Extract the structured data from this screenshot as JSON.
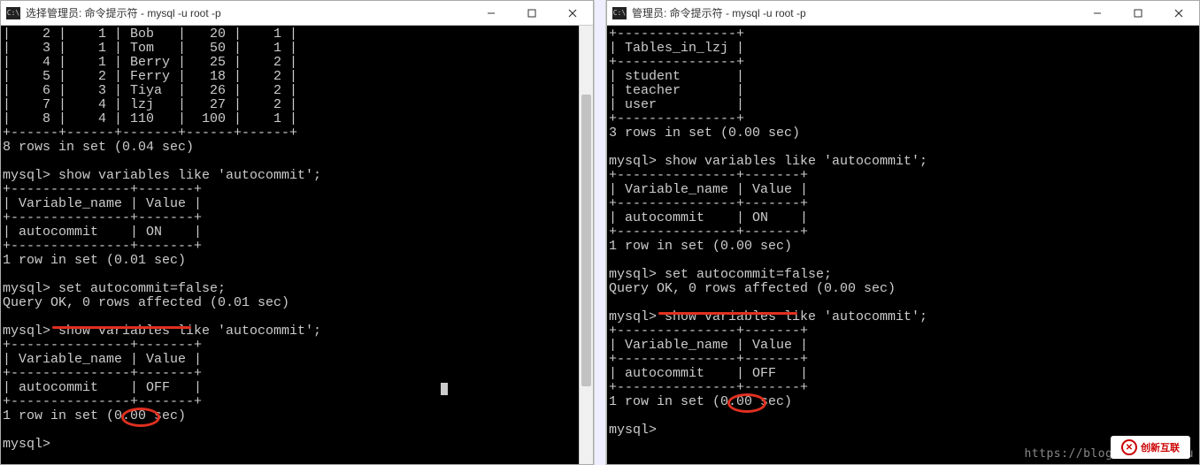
{
  "left": {
    "title": "选择管理员: 命令提示符 - mysql  -u root -p",
    "rows": [
      [
        "2",
        "1",
        "Bob",
        "20",
        "1"
      ],
      [
        "3",
        "1",
        "Tom",
        "50",
        "1"
      ],
      [
        "4",
        "1",
        "Berry",
        "25",
        "2"
      ],
      [
        "5",
        "2",
        "Ferry",
        "18",
        "2"
      ],
      [
        "6",
        "3",
        "Tiya",
        "26",
        "2"
      ],
      [
        "7",
        "4",
        "lzj",
        "27",
        "2"
      ],
      [
        "8",
        "4",
        "110",
        "100",
        "1"
      ]
    ],
    "sep_row": "+------+------+-------+------+------+",
    "rows_summary": "8 rows in set (0.04 sec)",
    "prompt": "mysql>",
    "cmd1": "show variables like 'autocommit';",
    "var_sep": "+---------------+-------+",
    "var_hdr": "| Variable_name | Value |",
    "var_on": "| autocommit    | ON    |",
    "var_off_pre": "| autocommit    |",
    "var_off_val": "OFF",
    "var_off_post": "   |",
    "one_row_01": "1 row in set (0.01 sec)",
    "one_row_00": "1 row in set (0.00 sec)",
    "cmd2_pre": "set autocommit=false",
    "cmd2_suf": ";",
    "query_ok": "Query OK, 0 rows affected (0.01 sec)"
  },
  "right": {
    "title": "管理员: 命令提示符 - mysql  -u root -p",
    "tbl_sep": "+---------------+",
    "tbl_hdr": "| Tables_in_lzj |",
    "tbl_r1": "| student       |",
    "tbl_r2": "| teacher       |",
    "tbl_r3": "| user          |",
    "rows_summary": "3 rows in set (0.00 sec)",
    "prompt": "mysql>",
    "cmd1": "show variables like 'autocommit';",
    "var_sep": "+---------------+-------+",
    "var_hdr": "| Variable_name | Value |",
    "var_on": "| autocommit    | ON    |",
    "var_off_pre": "| autocommit    |",
    "var_off_val": "OFF",
    "var_off_post": "   |",
    "one_row_00": "1 row in set (0.00 sec)",
    "cmd2_pre": "set autocommit=false",
    "cmd2_suf": ";",
    "query_ok": "Query OK, 0 rows affected (0.00 sec)"
  },
  "watermark": "https://blog.csdn.net/u",
  "logo_text": "创新互联"
}
